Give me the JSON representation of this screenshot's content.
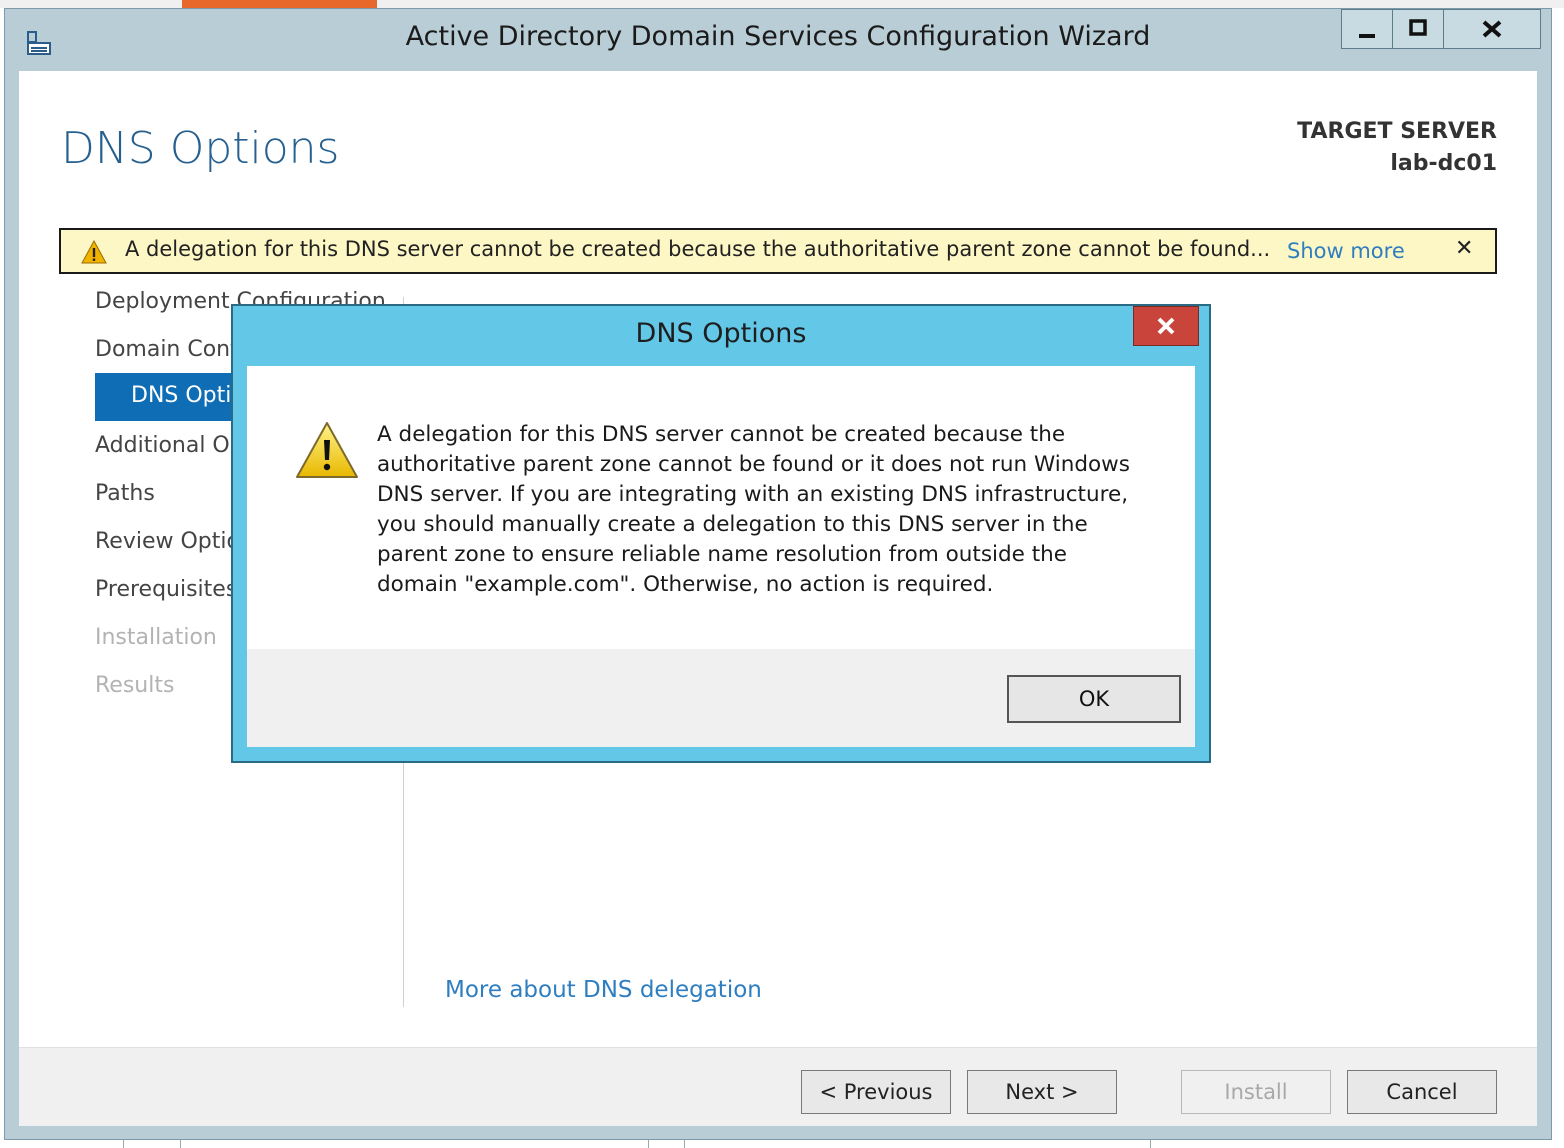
{
  "window": {
    "title": "Active Directory Domain Services Configuration Wizard",
    "controls": {
      "minimize": "▁",
      "maximize": "□",
      "close": "X"
    }
  },
  "page": {
    "title": "DNS Options",
    "target_server_label": "TARGET SERVER",
    "target_server_name": "lab-dc01"
  },
  "warning_bar": {
    "message": "A delegation for this DNS server cannot be created because the authoritative parent zone cannot be found...",
    "show_more": "Show more",
    "close": "✕"
  },
  "nav": {
    "items": [
      {
        "label": "Deployment Configuration",
        "state": "normal"
      },
      {
        "label": "Domain Controller Options",
        "state": "normal"
      },
      {
        "label": "DNS Options",
        "state": "selected"
      },
      {
        "label": "Additional Options",
        "state": "normal"
      },
      {
        "label": "Paths",
        "state": "normal"
      },
      {
        "label": "Review Options",
        "state": "normal"
      },
      {
        "label": "Prerequisites Check",
        "state": "normal"
      },
      {
        "label": "Installation",
        "state": "disabled"
      },
      {
        "label": "Results",
        "state": "disabled"
      }
    ]
  },
  "content": {
    "more_link": "More about DNS delegation"
  },
  "footer": {
    "previous": "< Previous",
    "next": "Next >",
    "install": "Install",
    "cancel": "Cancel"
  },
  "dialog": {
    "title": "DNS Options",
    "close": "x",
    "lines": [
      "A delegation for this DNS server cannot be created because the",
      "authoritative parent zone cannot be found or it does not run Windows",
      "DNS server. If you are integrating with an existing DNS infrastructure,",
      "you should manually create a delegation to this DNS server in the",
      "parent zone to ensure reliable name resolution from outside the",
      "domain \"example.com\". Otherwise, no action is required."
    ],
    "ok": "OK"
  },
  "colors": {
    "accent": "#0f6db5",
    "title_blue": "#26608f",
    "link": "#2f7ec0",
    "dialog_frame": "#63c7e8",
    "close_red": "#c9453b",
    "warning_bg": "#fdf6c5"
  }
}
